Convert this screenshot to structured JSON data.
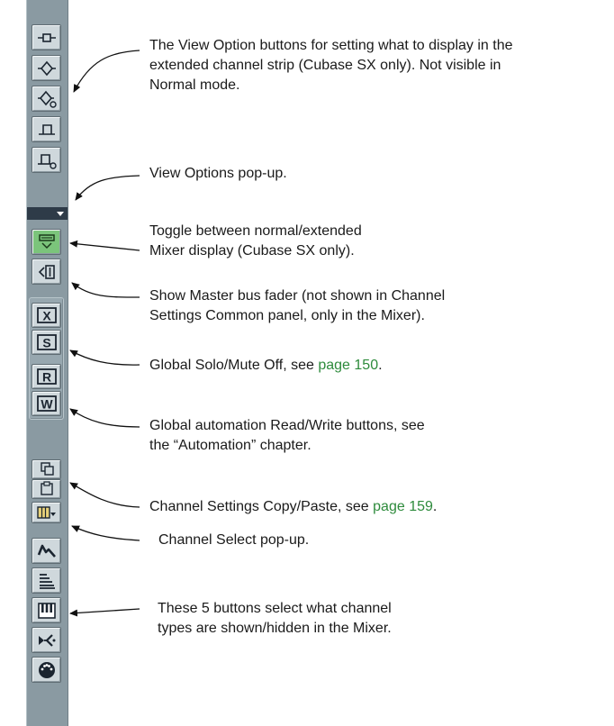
{
  "annotations": {
    "view_option_buttons": {
      "lines": [
        "The View Option buttons for setting what to display in the",
        "extended channel strip (Cubase SX only). Not visible in",
        "Normal mode."
      ]
    },
    "view_options_popup": {
      "text": "View Options pop-up."
    },
    "toggle_mixer_display": {
      "lines": [
        "Toggle between normal/extended",
        "Mixer display (Cubase SX only)."
      ]
    },
    "show_master_bus": {
      "lines": [
        "Show Master bus fader (not shown in Channel",
        "Settings Common panel, only in the Mixer)."
      ]
    },
    "global_solo_mute": {
      "text": "Global Solo/Mute Off, see ",
      "link": "page 150",
      "suffix": "."
    },
    "global_automation": {
      "lines": [
        "Global automation Read/Write buttons, see",
        "the “Automation” chapter."
      ]
    },
    "copy_paste": {
      "text": "Channel Settings Copy/Paste, see ",
      "link": "page 159",
      "suffix": "."
    },
    "channel_select": {
      "text": "Channel Select pop-up."
    },
    "channel_types": {
      "lines": [
        "These 5 buttons select what channel",
        "types are shown/hidden in the Mixer."
      ]
    }
  },
  "strip_buttons": {
    "global_buttons": [
      "X",
      "S",
      "R",
      "W"
    ]
  },
  "colors": {
    "strip": "#8a9aa2",
    "button_face": "#cfd8dc",
    "toggle_button": "#7bc47b",
    "popup_bar": "#2e3b48",
    "link": "#2e8b3c"
  }
}
